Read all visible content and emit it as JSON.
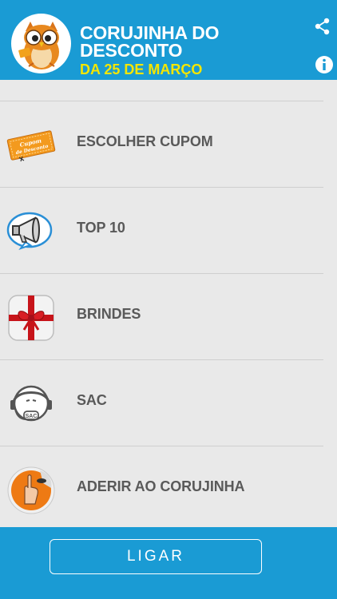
{
  "header": {
    "title_line1": "CORUJINHA DO",
    "title_line2": "DESCONTO",
    "subtitle": "DA 25 DE MARÇO",
    "logo_icon": "owl-logo-icon",
    "share_icon": "share-icon",
    "info_icon": "info-icon"
  },
  "menu": {
    "items": [
      {
        "label": "ESCOLHER CUPOM",
        "icon": "coupon-icon",
        "icon_text_1": "Cupom",
        "icon_text_2": "de Desconto"
      },
      {
        "label": "TOP 10",
        "icon": "megaphone-icon"
      },
      {
        "label": "BRINDES",
        "icon": "gift-icon"
      },
      {
        "label": "SAC",
        "icon": "support-headset-icon",
        "icon_text_1": "SAC"
      },
      {
        "label": "ADERIR AO CORUJINHA",
        "icon": "hand-sticker-icon"
      }
    ]
  },
  "footer": {
    "call_label": "LIGAR"
  },
  "colors": {
    "brand_blue": "#1a9bd4",
    "subtitle_yellow": "#f5e600",
    "background": "#e9e9e9",
    "label_gray": "#595959"
  }
}
